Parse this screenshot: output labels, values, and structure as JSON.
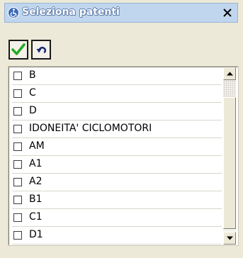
{
  "window": {
    "title": "Seleziona patenti",
    "close_label": "X"
  },
  "icons": {
    "title": "accessibility-icon",
    "close": "close-icon",
    "confirm": "checkmark-icon",
    "undo": "undo-icon",
    "scroll_up": "arrow-up-icon",
    "scroll_down": "arrow-down-icon"
  },
  "colors": {
    "checkmark": "#22aa22",
    "undo_arrow": "#1a2a7a",
    "title_bar": "#c0d6ee"
  },
  "list": {
    "items": [
      {
        "label": "B",
        "checked": false
      },
      {
        "label": "C",
        "checked": false
      },
      {
        "label": "D",
        "checked": false
      },
      {
        "label": "IDONEITA' CICLOMOTORI",
        "checked": false
      },
      {
        "label": "AM",
        "checked": false
      },
      {
        "label": "A1",
        "checked": false
      },
      {
        "label": "A2",
        "checked": false
      },
      {
        "label": "B1",
        "checked": false
      },
      {
        "label": "C1",
        "checked": false
      },
      {
        "label": "D1",
        "checked": false
      }
    ]
  }
}
